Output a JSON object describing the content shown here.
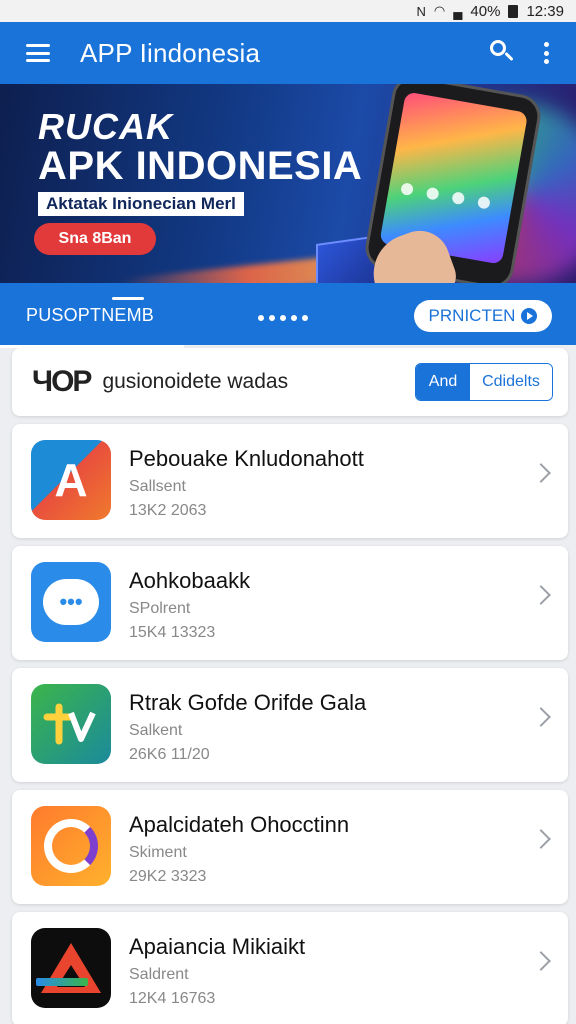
{
  "status_bar": {
    "battery": "40%",
    "time": "12:39"
  },
  "app_bar": {
    "title": "APP Iindonesia"
  },
  "banner": {
    "line1": "RUCAK",
    "line2": "APK INDONESIA",
    "subtitle": "Aktatak Inionecian Merl",
    "button": "Sna 8Ban"
  },
  "tabs": {
    "active_label": "PUSOPTNEMB",
    "pill_label": "PRNICTEN"
  },
  "filter": {
    "logo_text": "ЧОР",
    "label": "gusionoidete wadas",
    "segment_on": "And",
    "segment_off": "Cdidelts"
  },
  "apps": [
    {
      "name": "Pebouake Knludonahott",
      "category": "Sallsent",
      "meta": "13K2 2063",
      "icon": "letter-a-icon"
    },
    {
      "name": "Aohkobaakk",
      "category": "SPolrent",
      "meta": "15K4 13323",
      "icon": "chat-bubble-icon"
    },
    {
      "name": "Rtrak Gofde Orifde Gala",
      "category": "Salkent",
      "meta": "26K6 11/20",
      "icon": "tv-leaf-icon"
    },
    {
      "name": "Apalcidateh Ohocctinn",
      "category": "Skiment",
      "meta": "29K2 3323",
      "icon": "ring-g-icon"
    },
    {
      "name": "Apaiancia Mikiaikt",
      "category": "Saldrent",
      "meta": "12K4 16763",
      "icon": "triangle-icon"
    }
  ],
  "colors": {
    "primary": "#1a73d9",
    "accent_red": "#e23a3a"
  }
}
